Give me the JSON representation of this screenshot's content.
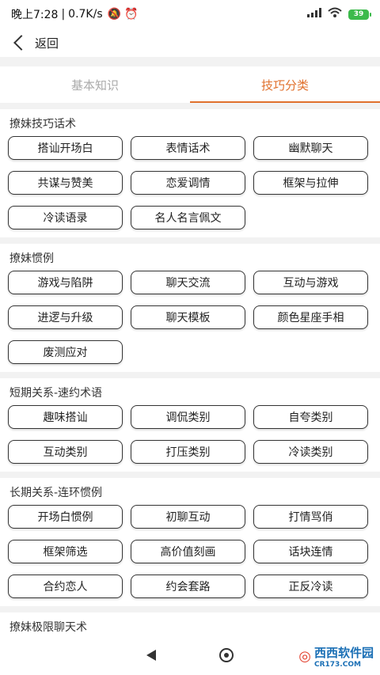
{
  "status": {
    "time": "晚上7:28",
    "speed": "0.7K/s",
    "battery": "39"
  },
  "topbar": {
    "back_label": "返回"
  },
  "tabs": [
    {
      "label": "基本知识",
      "active": false
    },
    {
      "label": "技巧分类",
      "active": true
    }
  ],
  "sections": [
    {
      "title": "撩妹技巧话术",
      "items": [
        "搭讪开场白",
        "表情话术",
        "幽默聊天",
        "共谋与赞美",
        "恋爱调情",
        "框架与拉伸",
        "冷读语录",
        "名人名言佩文"
      ]
    },
    {
      "title": "撩妹惯例",
      "items": [
        "游戏与陷阱",
        "聊天交流",
        "互动与游戏",
        "进逻与升级",
        "聊天模板",
        "颜色星座手相",
        "废测应对"
      ]
    },
    {
      "title": "短期关系-速约术语",
      "items": [
        "趣味搭讪",
        "调侃类别",
        "自夸类别",
        "互动类别",
        "打压类别",
        "冷读类别"
      ]
    },
    {
      "title": "长期关系-连环惯例",
      "items": [
        "开场白惯例",
        "初聊互动",
        "打情骂俏",
        "框架筛选",
        "高价值刻画",
        "话块连情",
        "合约恋人",
        "约会套路",
        "正反冷读"
      ]
    },
    {
      "title": "撩妹极限聊天术",
      "items": []
    }
  ],
  "watermark": {
    "main": "西西软件园",
    "sub": "CR173.COM"
  },
  "colors": {
    "accent": "#e0702c",
    "battery": "#3cba4b"
  }
}
